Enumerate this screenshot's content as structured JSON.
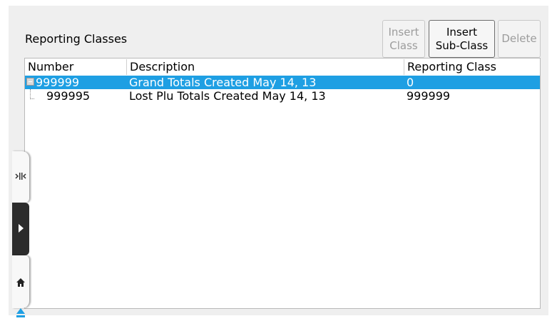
{
  "panel": {
    "title": "Reporting Classes"
  },
  "buttons": {
    "insert_class": [
      "Insert",
      "Class"
    ],
    "insert_sub_class": [
      "Insert",
      "Sub-Class"
    ],
    "delete": "Delete"
  },
  "table": {
    "columns": [
      "Number",
      "Description",
      "Reporting Class"
    ],
    "rows": [
      {
        "number": "999999",
        "description": "Grand Totals Created May 14, 13",
        "reporting_class": "0",
        "selected": true,
        "expanded": true
      },
      {
        "number": "999995",
        "description": "Lost Plu Totals Created May 14, 13",
        "reporting_class": "999999",
        "selected": false
      }
    ]
  },
  "dock": {
    "icons": [
      "collapse-arrows-icon",
      "play-icon",
      "home-icon",
      "eject-icon"
    ]
  },
  "colors": {
    "selection": "#1e9fe3",
    "panel_bg": "#efefef",
    "dock_dark": "#2c2c2c",
    "accent": "#1e9fe3"
  }
}
